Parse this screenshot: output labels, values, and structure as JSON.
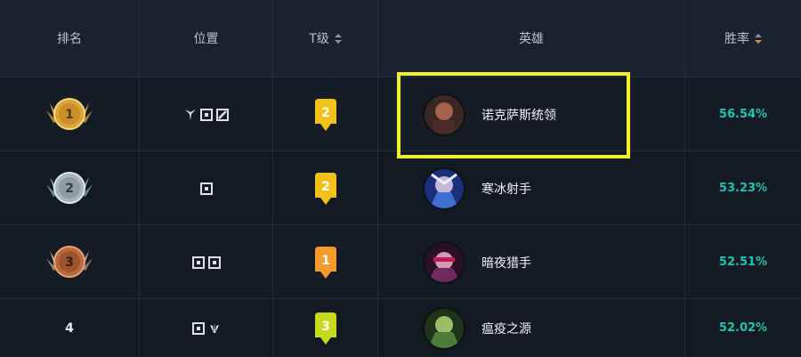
{
  "header": {
    "rank": "排名",
    "position": "位置",
    "tier": "T级",
    "hero": "英雄",
    "winrate": "胜率"
  },
  "rows": [
    {
      "rank": "1",
      "tier": "2",
      "hero": "诺克萨斯统领",
      "winrate": "56.54%",
      "tier_color": "#f3c21a",
      "avatar_color": "#7a3a32"
    },
    {
      "rank": "2",
      "tier": "2",
      "hero": "寒冰射手",
      "winrate": "53.23%",
      "tier_color": "#f3c21a",
      "avatar_color": "#3c56a8"
    },
    {
      "rank": "3",
      "tier": "1",
      "hero": "暗夜猎手",
      "winrate": "52.51%",
      "tier_color": "#f49a2a",
      "avatar_color": "#6e2a5c"
    },
    {
      "rank": "4",
      "tier": "3",
      "hero": "瘟疫之源",
      "winrate": "52.02%",
      "tier_color": "#c8d81c",
      "avatar_color": "#4d7b3a"
    }
  ],
  "colors": {
    "accent_winrate": "#1ec4b2",
    "highlight": "#f4ef2e",
    "gold": "#d9a53a",
    "silver": "#a7b4bb",
    "bronze": "#b86a3c"
  }
}
